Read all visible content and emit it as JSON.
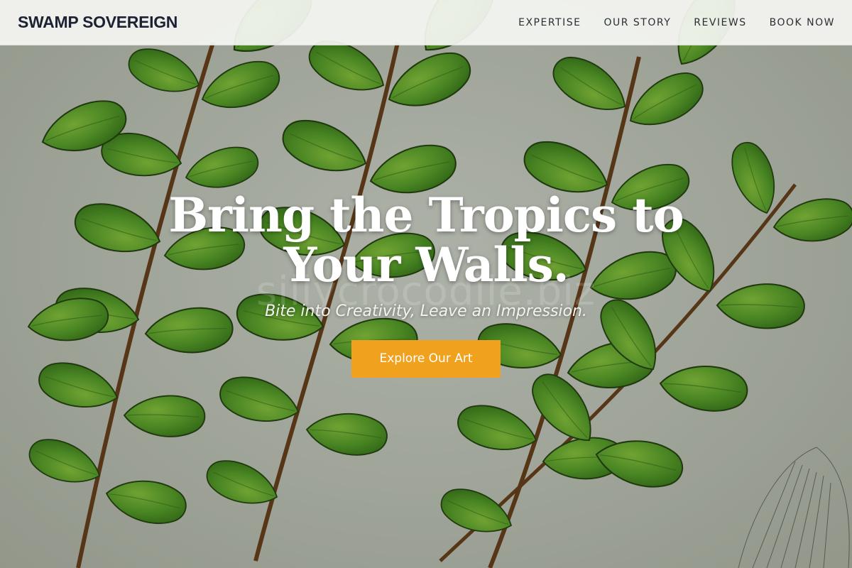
{
  "brand": {
    "name": "SWAMP SOVEREIGN"
  },
  "nav": {
    "items": [
      {
        "label": "EXPERTISE"
      },
      {
        "label": "OUR STORY"
      },
      {
        "label": "REVIEWS"
      },
      {
        "label": "BOOK NOW"
      }
    ]
  },
  "hero": {
    "headline": "Bring the Tropics to Your Walls.",
    "tagline": "Bite into Creativity, Leave an Impression.",
    "cta_label": "Explore Our Art",
    "background_image": "fern-illustration-image",
    "watermark": "sillycrocodile.biz"
  },
  "colors": {
    "accent": "#f0a11e",
    "brand_text": "#1c2233",
    "fern_green": "#5aa32a"
  }
}
